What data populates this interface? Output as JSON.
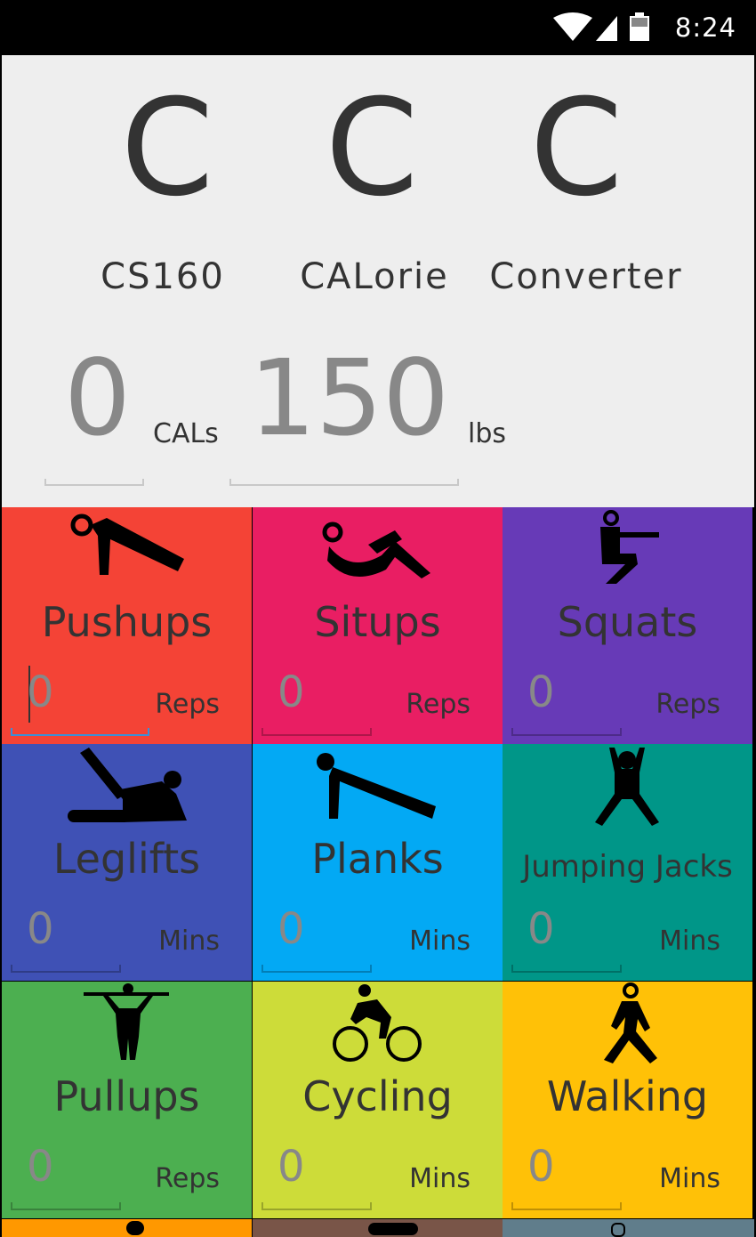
{
  "status": {
    "time": "8:24"
  },
  "header": {
    "letters": [
      "C",
      "C",
      "C"
    ],
    "words": [
      "CS160",
      "CALorie",
      "Converter"
    ],
    "calories": {
      "value": "0",
      "unit": "CALs"
    },
    "weight": {
      "value": "150",
      "unit": "lbs"
    }
  },
  "tiles": [
    {
      "name": "Pushups",
      "value": "0",
      "unit": "Reps",
      "color": "#f44336",
      "icon": "pushup-icon"
    },
    {
      "name": "Situps",
      "value": "0",
      "unit": "Reps",
      "color": "#e91e63",
      "icon": "situp-icon"
    },
    {
      "name": "Squats",
      "value": "0",
      "unit": "Reps",
      "color": "#673ab7",
      "icon": "squat-icon"
    },
    {
      "name": "Leglifts",
      "value": "0",
      "unit": "Mins",
      "color": "#3f51b5",
      "icon": "leglift-icon"
    },
    {
      "name": "Planks",
      "value": "0",
      "unit": "Mins",
      "color": "#03a9f4",
      "icon": "plank-icon"
    },
    {
      "name": "Jumping Jacks",
      "value": "0",
      "unit": "Mins",
      "color": "#009688",
      "icon": "jumping-jack-icon"
    },
    {
      "name": "Pullups",
      "value": "0",
      "unit": "Reps",
      "color": "#4caf50",
      "icon": "pullup-icon"
    },
    {
      "name": "Cycling",
      "value": "0",
      "unit": "Mins",
      "color": "#cddc39",
      "icon": "cycling-icon"
    },
    {
      "name": "Walking",
      "value": "0",
      "unit": "Mins",
      "color": "#ffc107",
      "icon": "walking-icon"
    }
  ],
  "peek_colors": [
    "#ff9800",
    "#795548",
    "#607d8b"
  ]
}
